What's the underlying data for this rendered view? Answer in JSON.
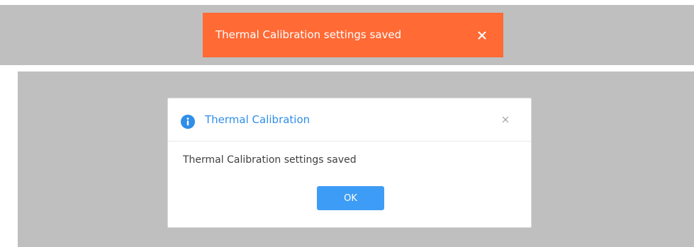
{
  "toast": {
    "message": "Thermal Calibration settings saved",
    "close_icon": "close-icon",
    "background_color": "#ff6a35",
    "text_color": "#ffffff"
  },
  "dialog": {
    "title": "Thermal Calibration",
    "title_icon": "info-icon",
    "title_color": "#2f8ee8",
    "close_icon": "close-icon",
    "message": "Thermal Calibration settings saved",
    "ok_label": "OK",
    "ok_color": "#3d9cf5"
  },
  "backdrop_color": "#bfbfbf"
}
